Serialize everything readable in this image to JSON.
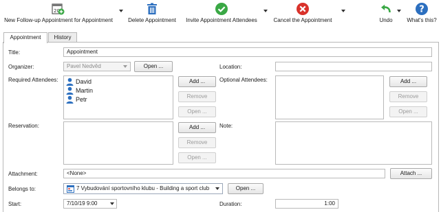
{
  "toolbar": {
    "new_followup": "New Follow-up Appointment for Appointment",
    "delete": "Delete Appointment",
    "invite": "Invite Appointment Attendees",
    "cancel": "Cancel the Appointment",
    "undo": "Undo",
    "whats_this": "What's this?"
  },
  "tabs": {
    "appointment": "Appointment",
    "history": "History"
  },
  "form": {
    "title_label": "Title:",
    "title_value": "Appointment",
    "organizer_label": "Organizer:",
    "organizer_value": "Pavel Nedvěd",
    "open_label": "Open ...",
    "location_label": "Location:",
    "location_value": "",
    "required_label": "Required Attendees:",
    "required_attendees": [
      "David",
      "Martin",
      "Petr"
    ],
    "optional_label": "Optional Attendees:",
    "add_label": "Add ...",
    "remove_label": "Remove",
    "open_small_label": "Open ...",
    "reservation_label": "Reservation:",
    "note_label": "Note:",
    "attachment_label": "Attachment:",
    "attachment_value": "<None>",
    "attach_label": "Attach ...",
    "belongs_label": "Belongs to:",
    "belongs_value": "7 Vybudování sportovního klubu - Building a sport club",
    "start_label": "Start:",
    "start_value": "7/10/19  9:00",
    "duration_label": "Duration:",
    "duration_value": "1:00"
  },
  "colors": {
    "green": "#3aa845",
    "red": "#d9322b",
    "blue": "#2c6fbf",
    "panel_border": "#b7b7b7"
  },
  "icons": [
    "calendar-plus-icon",
    "trash-icon",
    "check-circle-icon",
    "close-circle-icon",
    "undo-icon",
    "help-icon",
    "person-icon",
    "project-icon"
  ]
}
